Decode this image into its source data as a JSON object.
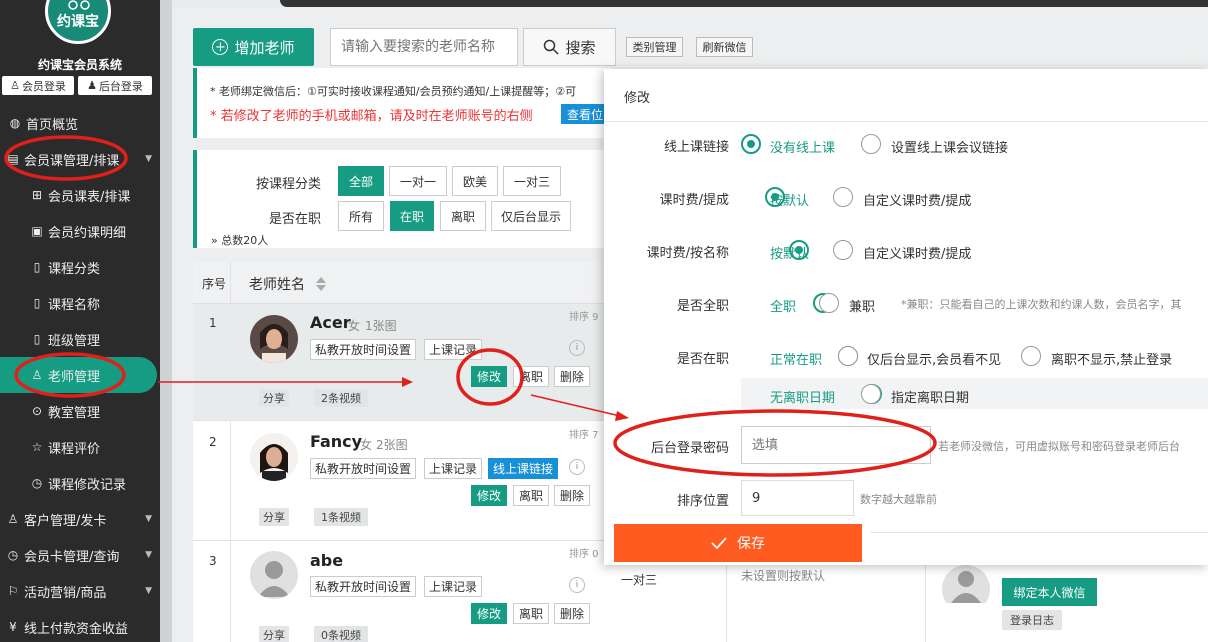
{
  "sidebar": {
    "logo_text": "约课宝",
    "system_name": "约课宝会员系统",
    "member_login": "会员登录",
    "admin_login": "后台登录",
    "items": [
      {
        "label": "首页概览",
        "icon": "globe-icon"
      },
      {
        "label": "会员课管理/排课",
        "icon": "calendar-icon"
      },
      {
        "label": "会员课表/排课",
        "icon": "book-icon"
      },
      {
        "label": "会员约课明细",
        "icon": "document-icon"
      },
      {
        "label": "课程分类",
        "icon": "file-icon"
      },
      {
        "label": "课程名称",
        "icon": "file-icon"
      },
      {
        "label": "班级管理",
        "icon": "file-icon"
      },
      {
        "label": "老师管理",
        "icon": "user-icon"
      },
      {
        "label": "教室管理",
        "icon": "location-icon"
      },
      {
        "label": "课程评价",
        "icon": "star-icon"
      },
      {
        "label": "课程修改记录",
        "icon": "clock-icon"
      },
      {
        "label": "客户管理/发卡",
        "icon": "user-icon"
      },
      {
        "label": "会员卡管理/查询",
        "icon": "clock-icon"
      },
      {
        "label": "活动营销/商品",
        "icon": "flag-icon"
      },
      {
        "label": "线上付款资金收益",
        "icon": "yen-icon"
      }
    ]
  },
  "toolbar": {
    "add_teacher": "增加老师",
    "search_placeholder": "请输入要搜索的老师名称",
    "search": "搜索",
    "category_manage": "类别管理",
    "refresh_wechat": "刷新微信"
  },
  "notice": {
    "line1": "* 老师绑定微信后：①可实时接收课程通知/会员预约通知/上课提醒等；②可",
    "line2": "* 若修改了老师的手机或邮箱，请及时在老师账号的右侧",
    "view_button": "查看位"
  },
  "filter": {
    "by_course_label": "按课程分类",
    "course_options": [
      "全部",
      "一对一",
      "欧美",
      "一对三"
    ],
    "employed_label": "是否在职",
    "employed_options": [
      "所有",
      "在职",
      "离职",
      "仅后台显示"
    ],
    "total": "总数20人"
  },
  "table": {
    "col_index": "序号",
    "col_name": "老师姓名",
    "rows": [
      {
        "index": "1",
        "name": "Acer",
        "gender": "女",
        "photos": "1张图",
        "sort": "排序 9",
        "btn_time": "私教开放时间设置",
        "btn_record": "上课记录",
        "btn_edit": "修改",
        "btn_leave": "离职",
        "btn_delete": "删除",
        "share": "分享",
        "videos": "2条视频"
      },
      {
        "index": "2",
        "name": "Fancy",
        "gender": "女",
        "photos": "2张图",
        "sort": "排序 7",
        "btn_time": "私教开放时间设置",
        "btn_record": "上课记录",
        "btn_online": "线上课链接",
        "btn_edit": "修改",
        "btn_leave": "离职",
        "btn_delete": "删除",
        "share": "分享",
        "videos": "1条视频"
      },
      {
        "index": "3",
        "name": "abe",
        "sort": "排序 0",
        "btn_time": "私教开放时间设置",
        "btn_record": "上课记录",
        "btn_edit": "修改",
        "btn_leave": "离职",
        "btn_delete": "删除",
        "share": "分享",
        "videos": "0条视频"
      }
    ]
  },
  "background": {
    "course_type": "一对三",
    "default_note": "未设置则按默认",
    "bind_wechat": "绑定本人微信",
    "login_log": "登录日志"
  },
  "modal": {
    "title": "修改",
    "online_link_label": "线上课链接",
    "online_opt1": "没有线上课",
    "online_opt2": "设置线上课会议链接",
    "fee_label": "课时费/提成",
    "fee_opt1": "按默认",
    "fee_opt2": "自定义课时费/提成",
    "fee_name_label": "课时费/按名称",
    "fee_name_opt1": "按默认",
    "fee_name_opt2": "自定义课时费/提成",
    "fulltime_label": "是否全职",
    "fulltime_opt1": "全职",
    "fulltime_opt2": "兼职",
    "fulltime_hint": "*兼职：只能看自己的上课次数和约课人数，会员名字，其",
    "employed_label": "是否在职",
    "employed_opt1": "正常在职",
    "employed_opt2": "仅后台显示,会员看不见",
    "employed_opt3": "离职不显示,禁止登录",
    "leave_opt1": "无离职日期",
    "leave_opt2": "指定离职日期",
    "password_label": "后台登录密码",
    "password_placeholder": "选填",
    "password_hint": "若老师没微信，可用虚拟账号和密码登录老师后台",
    "sort_label": "排序位置",
    "sort_value": "9",
    "sort_hint": "数字越大越靠前",
    "save": "保存"
  },
  "colors": {
    "accent": "#179c84",
    "sidebar": "#2b2b2b",
    "save": "#ff5a1f",
    "annotation": "#e0201b",
    "link_blue": "#1890d8"
  }
}
